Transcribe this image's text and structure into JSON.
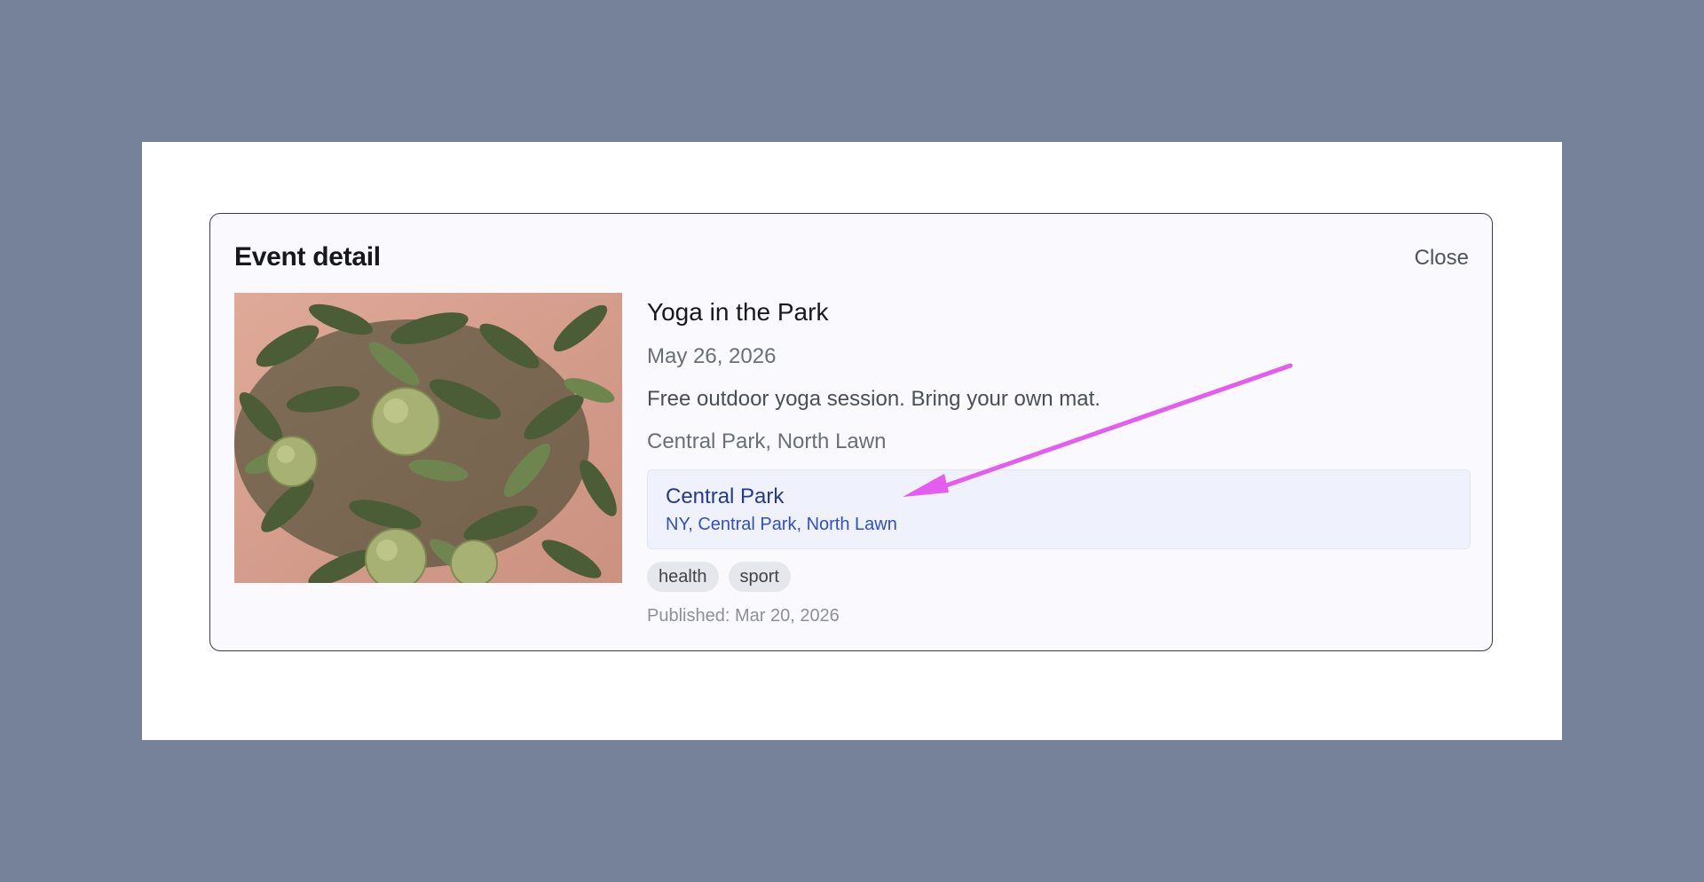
{
  "dialog": {
    "title": "Event detail",
    "close_label": "Close"
  },
  "event": {
    "image_icon": "photo-citrus-tree",
    "title": "Yoga in the Park",
    "date": "May 26, 2026",
    "description": "Free outdoor yoga session. Bring your own mat.",
    "location": "Central Park, North Lawn",
    "venue": {
      "name": "Central Park",
      "address": "NY, Central Park, North Lawn"
    },
    "tags": [
      "health",
      "sport"
    ],
    "published": "Published: Mar 20, 2026"
  },
  "colors": {
    "backdrop": "#76819a",
    "card_bg": "#f9f9fe",
    "venue_bg": "#eff2fd",
    "venue_name": "#243a8c",
    "venue_link": "#2f4fc6",
    "annotation_arrow": "#e55cf0"
  }
}
